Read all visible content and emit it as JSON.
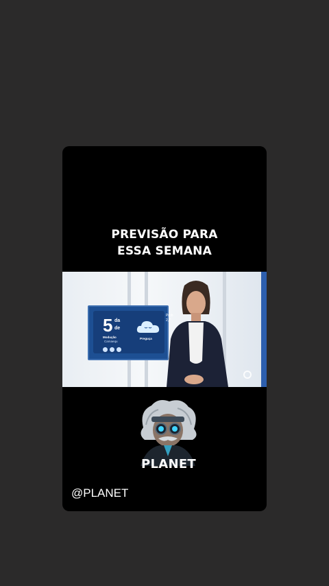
{
  "story": {
    "headline_line1": "PREVISÃO PARA",
    "headline_line2": "ESSA SEMANA",
    "brand_name": "PLANET",
    "handle": "@PLANET"
  },
  "video_frame": {
    "tv_number": "5",
    "tv_da": "da",
    "tv_de": "de",
    "tv_line1": "Modução",
    "tv_line2": "Camaequ",
    "tv_cloud_label": "Preguça",
    "tv_right_line1": "Prob",
    "tv_right_line2": "2,7"
  },
  "colors": {
    "background": "#2b2a2a",
    "card": "#000000",
    "tv_blue": "#1d4f93",
    "accent_cyan": "#3fd4ff"
  }
}
